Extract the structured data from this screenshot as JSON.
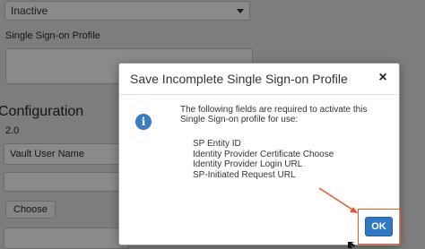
{
  "background_form": {
    "status_select": "Inactive",
    "sso_profile_label": "Single Sign-on Profile",
    "configuration_heading": "Configuration",
    "version_value": "2.0",
    "vault_user_field": "Vault User Name",
    "choose_button": "Choose"
  },
  "modal": {
    "title": "Save Incomplete Single Sign-on Profile",
    "close_symbol": "×",
    "icon": "info-icon",
    "message": "The following fields are required to activate this Single Sign-on profile for use:",
    "required_fields": [
      "SP Entity ID",
      "Identity Provider Certificate Choose",
      "Identity Provider Login URL",
      "SP-Initiated Request URL"
    ],
    "ok_button": "OK"
  },
  "annotation": {
    "highlight_color": "#e8572a"
  }
}
